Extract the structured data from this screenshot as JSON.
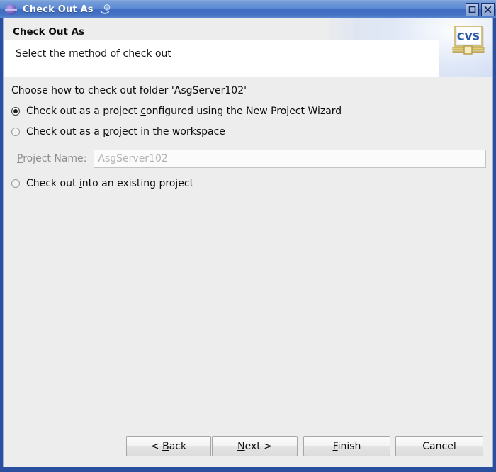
{
  "window": {
    "title": "Check Out As",
    "app_icon": "eclipse-sphere-icon",
    "title_decoration_icon": "swirl-icon",
    "controls": {
      "maximize_label": "Maximize",
      "close_label": "Close"
    },
    "colors": {
      "titlebar_top": "#88aade",
      "titlebar_bottom": "#5d8ad3",
      "frame_border": "#2a4f9e",
      "dialog_background": "#ededed",
      "banner_background": "#ffffff",
      "cvs_logo_blue": "#2a5aa8",
      "cvs_logo_gold": "#d9c156"
    }
  },
  "banner": {
    "title": "Check Out As",
    "description": "Select the method of check out",
    "logo_text": "CVS",
    "logo_name": "cvs-logo"
  },
  "content": {
    "choose_label": "Choose how to check out folder 'AsgServer102'",
    "options": [
      {
        "id": "configured-wizard",
        "label_before": "Check out as a project ",
        "mnemonic": "c",
        "label_after": "onfigured using the New Project Wizard",
        "full_label": "Check out as a project configured using the New Project Wizard",
        "selected": true
      },
      {
        "id": "project-in-workspace",
        "label_before": "Check out as a ",
        "mnemonic": "p",
        "label_after": "roject in the workspace",
        "full_label": "Check out as a project in the workspace",
        "selected": false
      },
      {
        "id": "existing-project",
        "label_before": "Check out ",
        "mnemonic": "i",
        "label_after": "nto an existing project",
        "full_label": "Check out into an existing project",
        "selected": false
      }
    ],
    "project_name": {
      "label_mnemonic": "P",
      "label_rest": "roject Name:",
      "full_label": "Project Name:",
      "value": "AsgServer102",
      "placeholder": "AsgServer102",
      "disabled": true
    }
  },
  "buttons": {
    "back": {
      "prefix": "< ",
      "mnemonic": "B",
      "suffix": "ack",
      "full_label": "< Back",
      "enabled": true
    },
    "next": {
      "prefix": "",
      "mnemonic": "N",
      "suffix": "ext >",
      "full_label": "Next >",
      "enabled": true
    },
    "finish": {
      "prefix": "",
      "mnemonic": "F",
      "suffix": "inish",
      "full_label": "Finish",
      "enabled": true
    },
    "cancel": {
      "prefix": "",
      "mnemonic": "",
      "suffix": "Cancel",
      "full_label": "Cancel",
      "enabled": true
    }
  }
}
